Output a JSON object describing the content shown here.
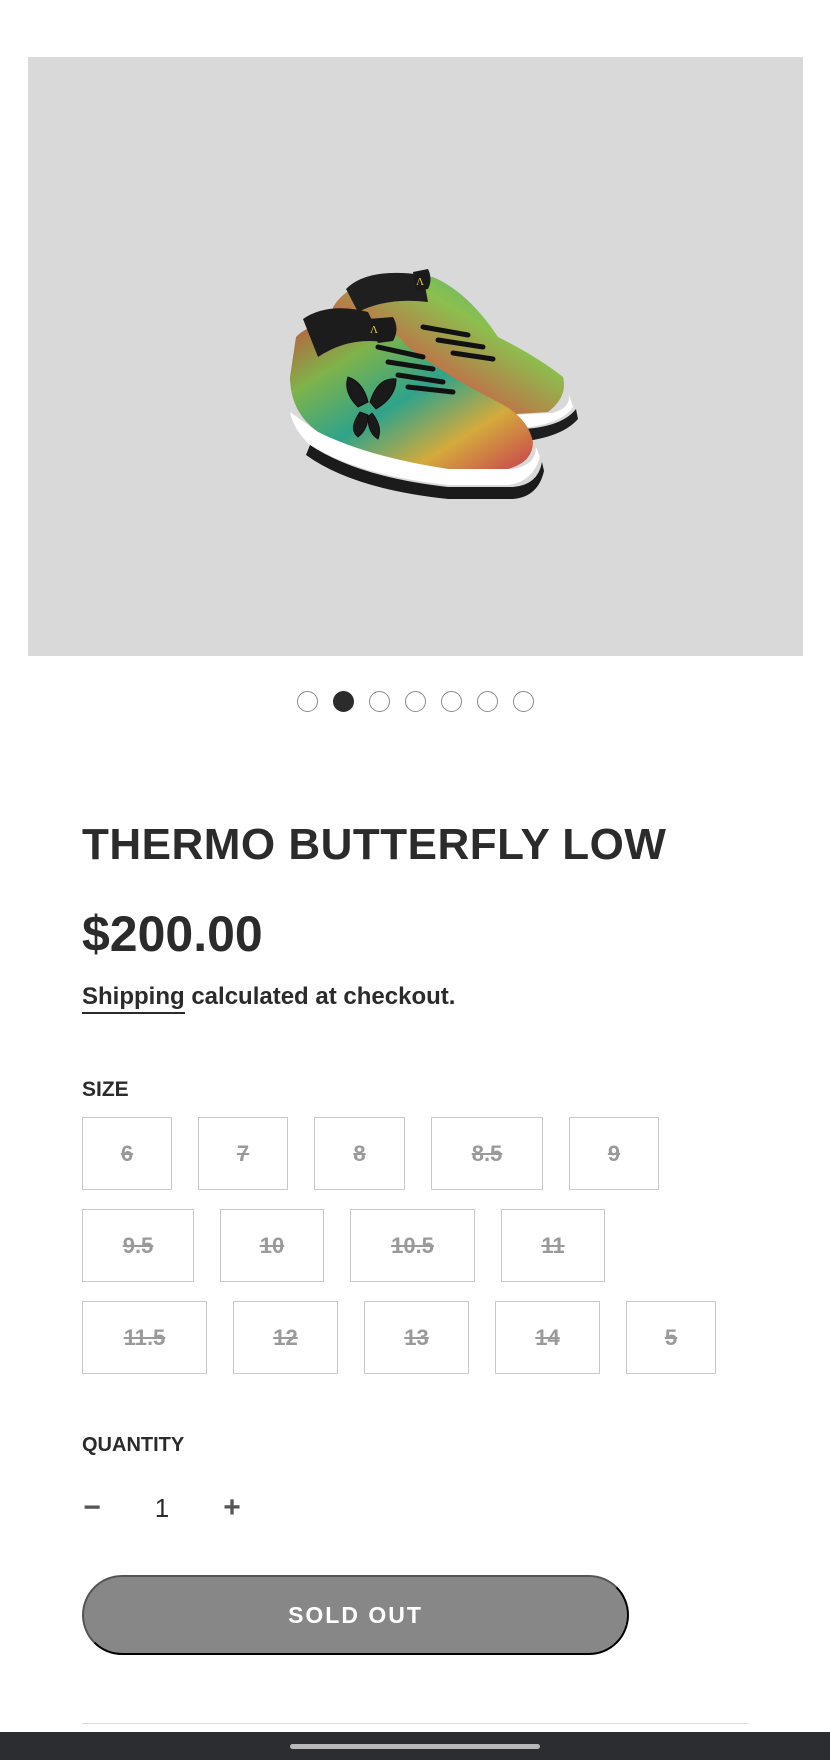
{
  "product": {
    "title": "THERMO BUTTERFLY LOW",
    "price": "$200.00",
    "shipping_link": "Shipping",
    "shipping_text": " calculated at checkout.",
    "image_icon": "sneaker-pair-image"
  },
  "gallery": {
    "dot_count": 7,
    "active_index": 1
  },
  "size": {
    "label": "SIZE",
    "rows": [
      [
        "6",
        "7",
        "8",
        "8.5",
        "9"
      ],
      [
        "9.5",
        "10",
        "10.5",
        "11"
      ],
      [
        "11.5",
        "12",
        "13",
        "14",
        "5"
      ]
    ],
    "all_unavailable": true
  },
  "quantity": {
    "label": "QUANTITY",
    "minus": "−",
    "value": "1",
    "plus": "+"
  },
  "cta": {
    "label": "SOLD OUT"
  },
  "colors": {
    "text": "#2b2b2b",
    "image_bg": "#d9d9d9",
    "button_disabled": "#878787",
    "nav_bar": "#2b2d31"
  }
}
